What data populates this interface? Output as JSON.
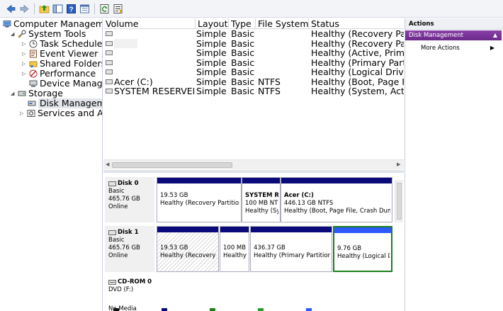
{
  "icons": {
    "back": "back-arrow-icon",
    "forward": "forward-arrow-icon",
    "up": "up-folder-icon",
    "console": "show-hide-console-tree-icon",
    "help": "help-icon",
    "properties": "properties-icon",
    "refresh": "refresh-icon",
    "export": "export-list-icon"
  },
  "colors": {
    "primary_partition": "#0a0a7a",
    "logical_drive": "#2f59ff",
    "logical_border": "#1d7f1d",
    "actions_band": "#7b3598"
  },
  "tree": {
    "root": "Computer Managem",
    "system_tools": "System Tools",
    "task_scheduler": "Task Scheduler",
    "event_viewer": "Event Viewer",
    "shared_folders": "Shared Folders",
    "performance": "Performance",
    "device_manager": "Device Manage",
    "storage": "Storage",
    "disk_management": "Disk Manageme",
    "services": "Services and Appl"
  },
  "volumes": {
    "columns": [
      "Volume",
      "Layout",
      "Type",
      "File System",
      "Status"
    ],
    "rows": [
      {
        "volume": "",
        "layout": "Simple",
        "type": "Basic",
        "fs": "",
        "status": "Healthy (Recovery Par"
      },
      {
        "volume": "",
        "layout": "Simple",
        "type": "Basic",
        "fs": "",
        "status": "Healthy (Recovery Par"
      },
      {
        "volume": "",
        "layout": "Simple",
        "type": "Basic",
        "fs": "",
        "status": "Healthy (Active, Prima"
      },
      {
        "volume": "",
        "layout": "Simple",
        "type": "Basic",
        "fs": "",
        "status": "Healthy (Primary Parti"
      },
      {
        "volume": "",
        "layout": "Simple",
        "type": "Basic",
        "fs": "",
        "status": "Healthy (Logical Drive"
      },
      {
        "volume": "Acer (C:)",
        "layout": "Simple",
        "type": "Basic",
        "fs": "NTFS",
        "status": "Healthy (Boot, Page F"
      },
      {
        "volume": "SYSTEM RESERVED",
        "layout": "Simple",
        "type": "Basic",
        "fs": "NTFS",
        "status": "Healthy (System, Acti"
      }
    ]
  },
  "disks": [
    {
      "name": "Disk 0",
      "type": "Basic",
      "size": "465.76 GB",
      "state": "Online",
      "partitions": [
        {
          "name": "",
          "size": "19.53 GB",
          "status": "Healthy (Recovery Partition)"
        },
        {
          "name": "SYSTEM RE",
          "size": "100 MB NTF",
          "status": "Healthy (Sy:"
        },
        {
          "name": "Acer  (C:)",
          "size": "446.13 GB NTFS",
          "status": "Healthy (Boot, Page File, Crash Dump, P"
        }
      ]
    },
    {
      "name": "Disk 1",
      "type": "Basic",
      "size": "465.76 GB",
      "state": "Online",
      "partitions": [
        {
          "name": "",
          "size": "19.53 GB",
          "status": "Healthy (Recovery Pa"
        },
        {
          "name": "",
          "size": "100 MB",
          "status": "Healthy"
        },
        {
          "name": "",
          "size": "436.37 GB",
          "status": "Healthy (Primary Partition)"
        },
        {
          "name": "",
          "size": "9.76 GB",
          "status": "Healthy (Logical D"
        }
      ]
    },
    {
      "name": "CD-ROM 0",
      "type": "DVD (F:)",
      "size": "",
      "state": "No Media",
      "partitions": []
    }
  ],
  "actions": {
    "header": "Actions",
    "section": "Disk Management",
    "more": "More Actions"
  }
}
